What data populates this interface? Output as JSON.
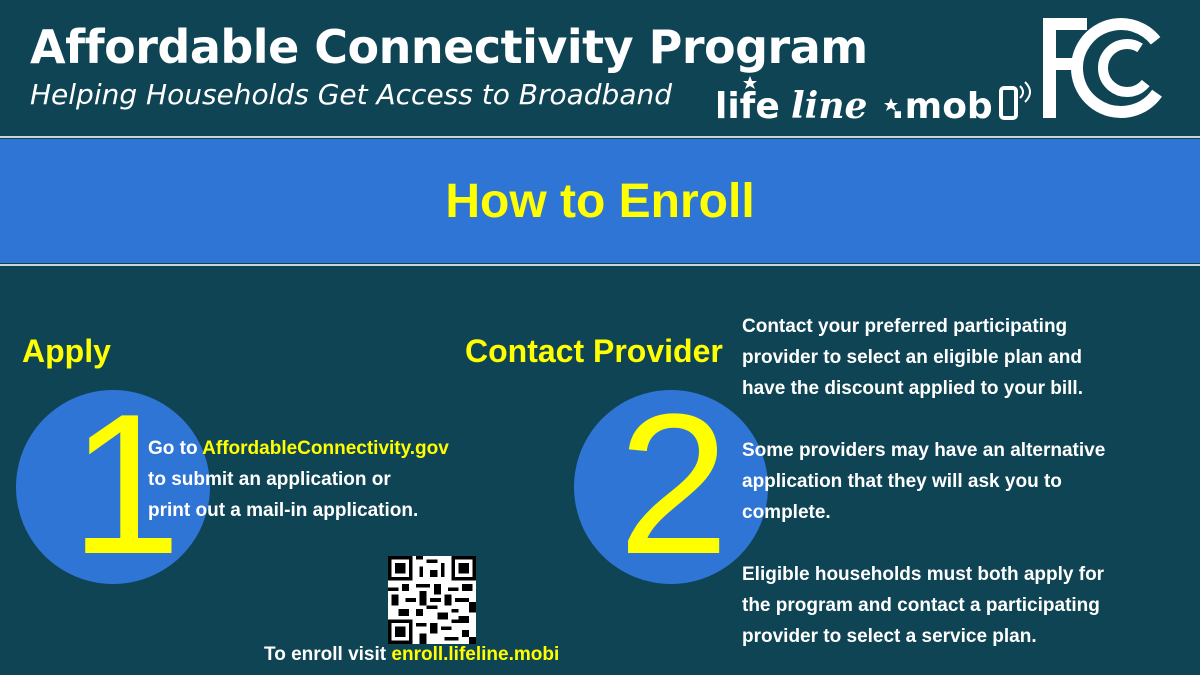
{
  "header": {
    "title": "Affordable Connectivity Program",
    "subtitle": "Helping Households Get Access to Broadband",
    "lifeline_logo": {
      "part1": "life",
      "part2": "line",
      "part3": ".mob"
    },
    "fcc_logo": "FCC"
  },
  "banner": {
    "title": "How to Enroll"
  },
  "step1": {
    "heading": "Apply",
    "number": "1",
    "line1_prefix": "Go to ",
    "line1_link": "AffordableConnectivity.gov",
    "line2": "to submit an application or",
    "line3": "print out a mail-in application."
  },
  "step2": {
    "heading": "Contact Provider",
    "number": "2",
    "para1": [
      "Contact your preferred participating",
      "provider to select an eligible plan and",
      "have the discount applied to your bill."
    ],
    "para2": [
      "Some providers may have an alternative",
      "application that they will ask you to",
      "complete."
    ],
    "para3": [
      "Eligible households must both apply for",
      "the program and contact a participating",
      "provider to select a service plan."
    ]
  },
  "enroll": {
    "prefix": "To enroll visit ",
    "link": "enroll.lifeline.mobi"
  },
  "colors": {
    "background": "#0f4455",
    "banner": "#2f75d6",
    "accent": "#ffff00",
    "text": "#ffffff"
  }
}
